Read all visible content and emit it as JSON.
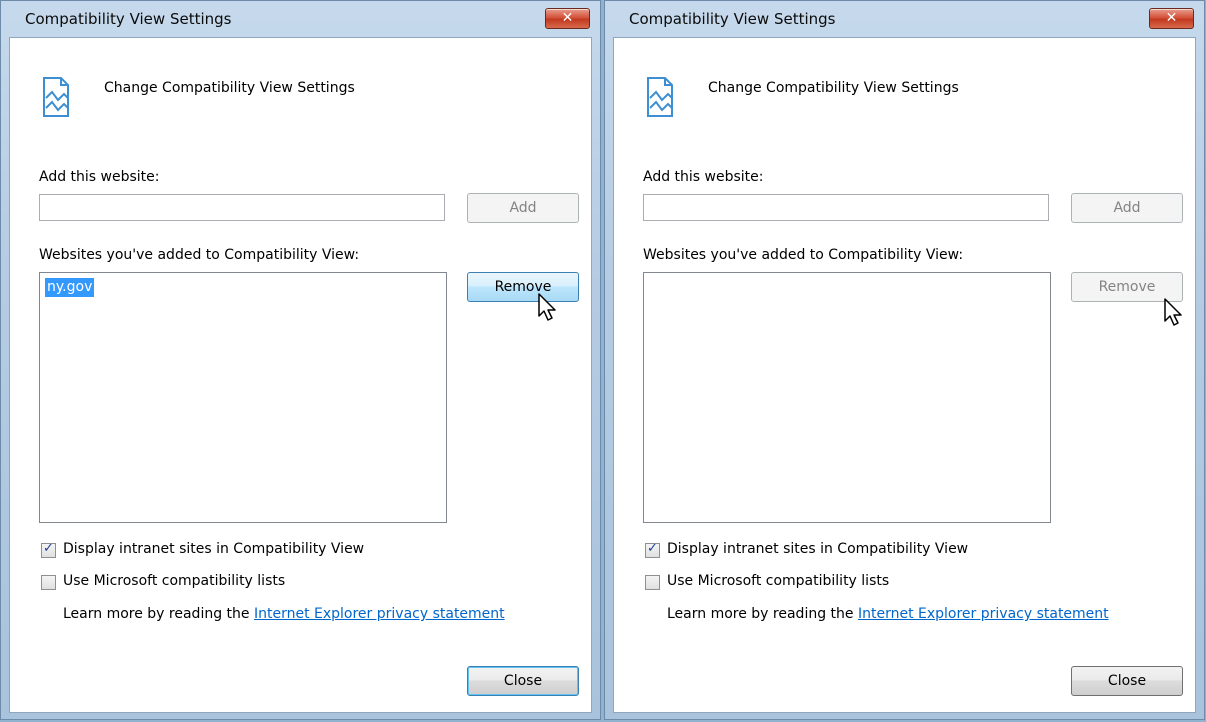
{
  "left_dialog": {
    "title": "Compatibility View Settings",
    "close_glyph": "✕",
    "header_text": "Change Compatibility View Settings",
    "add_label": "Add this website:",
    "add_value": "",
    "add_button": "Add",
    "list_label": "Websites you've added to Compatibility View:",
    "list_items": [
      "ny.gov"
    ],
    "selected_index": 0,
    "remove_button": "Remove",
    "remove_state": "hover",
    "intranet_label": "Display intranet sites in Compatibility View",
    "intranet_checked": true,
    "mslists_label": "Use Microsoft compatibility lists",
    "mslists_checked": false,
    "learn_text": "Learn more by reading the ",
    "learn_link": "Internet Explorer privacy statement",
    "close_button": "Close"
  },
  "right_dialog": {
    "title": "Compatibility View Settings",
    "close_glyph": "✕",
    "header_text": "Change Compatibility View Settings",
    "add_label": "Add this website:",
    "add_value": "",
    "add_button": "Add",
    "list_label": "Websites you've added to Compatibility View:",
    "list_items": [],
    "remove_button": "Remove",
    "remove_state": "disabled",
    "intranet_label": "Display intranet sites in Compatibility View",
    "intranet_checked": true,
    "mslists_label": "Use Microsoft compatibility lists",
    "mslists_checked": false,
    "learn_text": "Learn more by reading the ",
    "learn_link": "Internet Explorer privacy statement",
    "close_button": "Close"
  },
  "colors": {
    "selection": "#3399ff",
    "link": "#0066cc",
    "close_red": "#c1391f",
    "frame": "#b4cbe3"
  },
  "icons": {
    "header": "compatibility-view-icon",
    "cursor": "mouse-pointer-icon",
    "check": "checkmark-icon"
  }
}
